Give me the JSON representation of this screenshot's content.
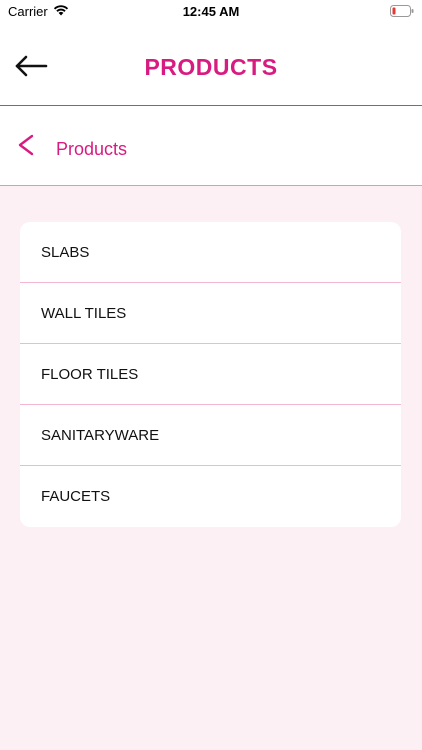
{
  "status_bar": {
    "carrier": "Carrier",
    "time": "12:45 AM",
    "wifi_icon": "wifi-icon",
    "battery_icon": "battery-low-icon"
  },
  "header": {
    "title": "PRODUCTS",
    "back_icon": "arrow-left-icon"
  },
  "breadcrumb": {
    "back_icon": "chevron-left-icon",
    "label": "Products"
  },
  "products": [
    {
      "label": "SLABS"
    },
    {
      "label": "WALL TILES"
    },
    {
      "label": "FLOOR TILES"
    },
    {
      "label": "SANITARYWARE"
    },
    {
      "label": "FAUCETS"
    }
  ],
  "colors": {
    "accent": "#d81b80",
    "background": "#fdf0f5",
    "divider": "#f4b7d3",
    "battery_low": "#e53935"
  }
}
